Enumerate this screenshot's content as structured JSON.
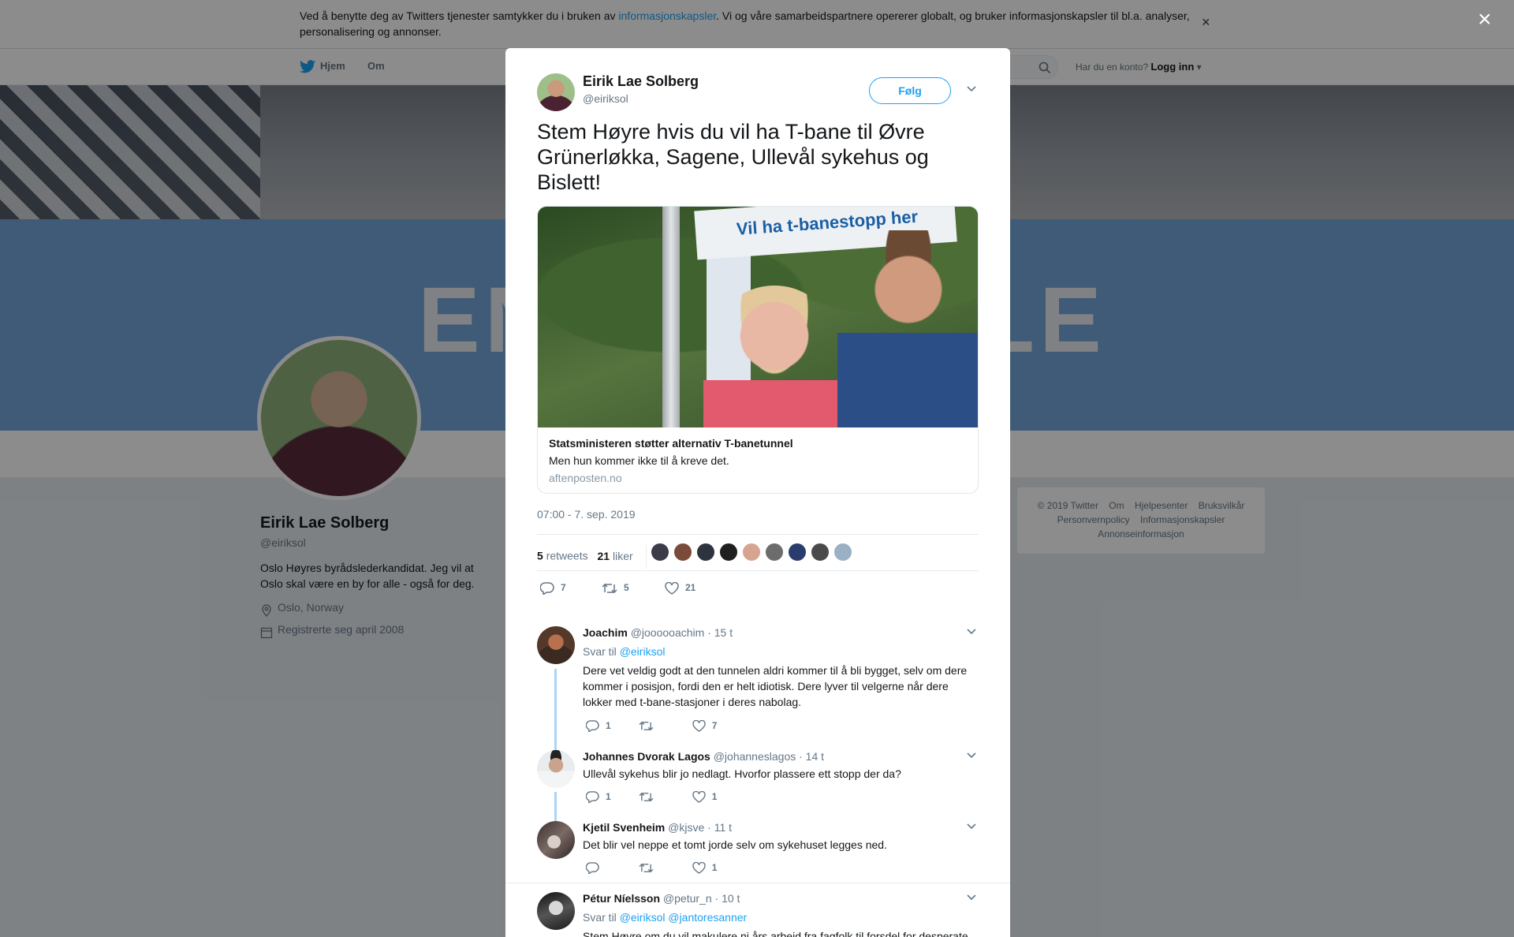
{
  "cookie": {
    "text_before": "Ved å benytte deg av Twitters tjenester samtykker du i bruken av ",
    "link": "informasjonskapsler",
    "text_after": ". Vi og våre samarbeidspartnere opererer globalt, og bruker informasjonskapsler til bl.a. analyser, personalisering og annonser.",
    "close": "×"
  },
  "nav": {
    "home": "Hjem",
    "about": "Om",
    "have_account": "Har du en konto?",
    "login": "Logg inn"
  },
  "banner": {
    "text_left": "EN",
    "text_right": "LE"
  },
  "profile": {
    "name": "Eirik Lae Solberg",
    "handle": "@eiriksol",
    "bio": "Oslo Høyres byrådslederkandidat. Jeg vil at Oslo skal være en by for alle - også for deg.",
    "location": "Oslo, Norway",
    "joined": "Registrerte seg april 2008"
  },
  "footer": {
    "items": [
      "© 2019 Twitter",
      "Om",
      "Hjelpesenter",
      "Bruksvilkår",
      "Personvernpolicy",
      "Informasjonskapsler",
      "Annonseinformasjon"
    ]
  },
  "modal": {
    "close": "×",
    "author_name": "Eirik Lae Solberg",
    "author_handle": "@eiriksol",
    "follow": "Følg",
    "text": "Stem Høyre hvis du vil ha T-bane til Øvre Grünerløkka, Sagene, Ullevål sykehus og Bislett!",
    "card": {
      "sign_text": "Vil ha t-banestopp her",
      "title": "Statsministeren støtter alternativ T-banetunnel",
      "description": "Men hun kommer ikke til å kreve det.",
      "domain": "aftenposten.no"
    },
    "timestamp": "07:00 - 7. sep. 2019",
    "retweets_count": "5",
    "retweets_label": "retweets",
    "likes_count": "21",
    "likes_label": "liker",
    "actions": {
      "replies": "7",
      "retweets": "5",
      "likes": "21"
    },
    "liker_colors": [
      "#3b3b4a",
      "#7a4a3a",
      "#2e3340",
      "#1f1f1f",
      "#d7a58f",
      "#6c6c6c",
      "#2a3c6e",
      "#4a4a4a",
      "#9ab0c4"
    ]
  },
  "replies": [
    {
      "name": "Joachim",
      "handle": "@joooooachim",
      "time": "· 15 t",
      "reply_to_label": "Svar til",
      "reply_to": "@eiriksol",
      "text": "Dere vet veldig godt at den tunnelen aldri kommer til å bli bygget, selv om dere kommer i posisjon, fordi den er helt idiotisk. Dere lyver til velgerne når dere lokker med t-bane-stasjoner i deres nabolag.",
      "replies": "1",
      "retweets": "",
      "likes": "7"
    },
    {
      "name": "Johannes Dvorak Lagos",
      "handle": "@johanneslagos",
      "time": "· 14 t",
      "text": "Ullevål sykehus blir jo nedlagt. Hvorfor plassere ett stopp der da?",
      "replies": "1",
      "retweets": "",
      "likes": "1"
    },
    {
      "name": "Kjetil Svenheim",
      "handle": "@kjsve",
      "time": "· 11 t",
      "text": "Det blir vel neppe et tomt jorde selv om sykehuset legges ned.",
      "replies": "",
      "retweets": "",
      "likes": "1"
    },
    {
      "name": "Pétur Níelsson",
      "handle": "@petur_n",
      "time": "· 10 t",
      "reply_to_label": "Svar til",
      "reply_to": "@eiriksol @jantoresanner",
      "text": "Stem Høyre om du vil makulere ni års arbeid fra fagfolk til forsdel for desperate",
      "replies": "",
      "retweets": "",
      "likes": ""
    }
  ]
}
